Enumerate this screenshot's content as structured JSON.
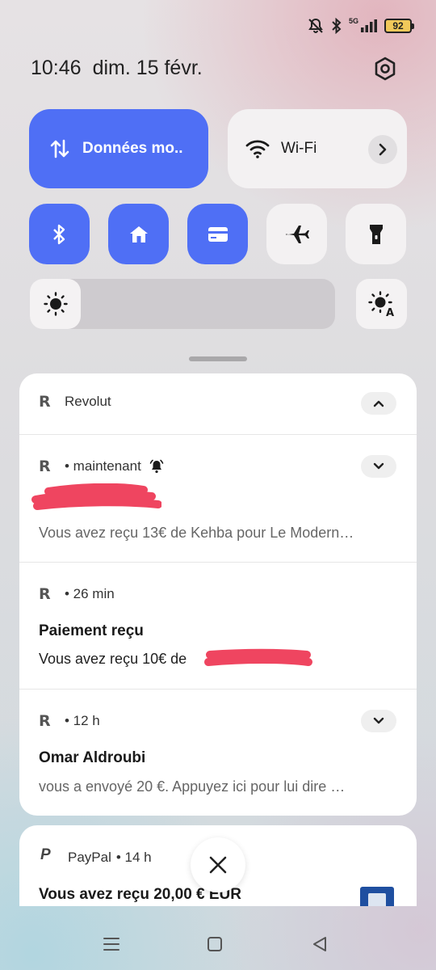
{
  "status_bar": {
    "network_label": "5G",
    "battery_level": "92",
    "icons": [
      "mute-bell-icon",
      "bluetooth-icon",
      "signal-icon",
      "battery-icon"
    ]
  },
  "header": {
    "time": "10:46",
    "date": "dim. 15 févr."
  },
  "quick_settings": {
    "mobile_data_label": "Données mo..",
    "wifi_label": "Wi-Fi",
    "tiles": [
      {
        "name": "bluetooth",
        "state": "on"
      },
      {
        "name": "home",
        "state": "on"
      },
      {
        "name": "wallet",
        "state": "on"
      },
      {
        "name": "airplane",
        "state": "off"
      },
      {
        "name": "flashlight",
        "state": "off"
      }
    ],
    "brightness_level": 0.05,
    "auto_brightness_label": "A"
  },
  "colors": {
    "accent": "#4f6ff5",
    "tile_off": "#f3f1f2",
    "redaction": "#ef4560"
  },
  "notifications": {
    "group_app": "Revolut",
    "items": [
      {
        "meta": "• maintenant",
        "title": "",
        "body": "Vous avez reçu 13€ de Kehba pour Le Modern…"
      },
      {
        "meta": "• 26 min",
        "title": "Paiement reçu",
        "body": "Vous avez reçu 10€ de"
      },
      {
        "meta": "• 12 h",
        "title": "Omar Aldroubi",
        "body": "vous a envoyé 20 €. Appuyez ici pour lui dire …"
      }
    ]
  },
  "paypal": {
    "app": "PayPal",
    "meta": "• 14 h",
    "title": "Vous avez reçu 20,00 € EUR"
  }
}
